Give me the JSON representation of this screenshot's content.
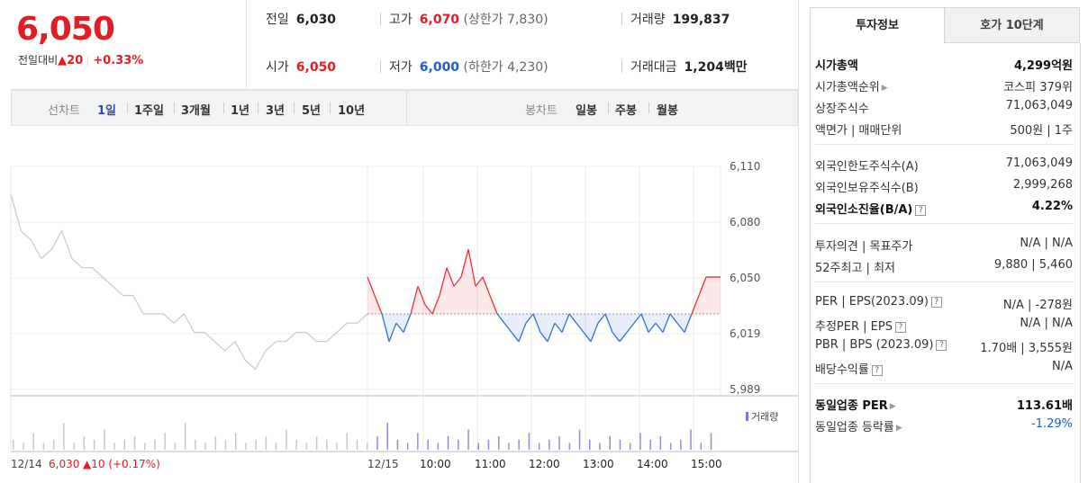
{
  "quote": {
    "price": "6,050",
    "change_label": "전일대비",
    "change_arrow": "▲",
    "change_amount": "20",
    "change_rate": "+0.33%",
    "prev_close_label": "전일",
    "prev_close": "6,030",
    "open_label": "시가",
    "open": "6,050",
    "high_label": "고가",
    "high": "6,070",
    "upper_limit": "(상한가 7,830)",
    "low_label": "저가",
    "low": "6,000",
    "lower_limit": "(하한가 4,230)",
    "volume_label": "거래량",
    "volume": "199,837",
    "amount_label": "거래대금",
    "amount": "1,204",
    "amount_unit": "백만"
  },
  "toolbar": {
    "line_label": "선차트",
    "periods": [
      "1일",
      "1주일",
      "3개월",
      "1년",
      "3년",
      "5년",
      "10년"
    ],
    "selected_period": "1일",
    "candle_label": "봉차트",
    "candles": [
      "일봉",
      "주봉",
      "월봉"
    ]
  },
  "chart_data": {
    "type": "line",
    "y_ticks": [
      "6,110",
      "6,080",
      "6,050",
      "6,019",
      "5,989"
    ],
    "ylim": [
      5989,
      6110
    ],
    "base_price": 6030,
    "x_ticks": [
      "12/15",
      "10:00",
      "11:00",
      "12:00",
      "13:00",
      "14:00",
      "15:00"
    ],
    "prev_day_label": "12/14",
    "prev_day_price": "6,030",
    "prev_day_change": "▲10 (+0.17%)",
    "volume_legend": "거래량",
    "prev_day_series": {
      "name": "12/14",
      "values": [
        6095,
        6075,
        6070,
        6060,
        6065,
        6075,
        6060,
        6055,
        6055,
        6050,
        6045,
        6040,
        6040,
        6030,
        6030,
        6030,
        6025,
        6030,
        6020,
        6020,
        6015,
        6010,
        6015,
        6005,
        6000,
        6010,
        6015,
        6015,
        6020,
        6020,
        6015,
        6015,
        6020,
        6025,
        6025,
        6030
      ]
    },
    "today_series": {
      "name": "12/15",
      "values": [
        6050,
        6040,
        6030,
        6015,
        6025,
        6020,
        6030,
        6045,
        6035,
        6030,
        6040,
        6055,
        6045,
        6050,
        6065,
        6045,
        6050,
        6040,
        6030,
        6025,
        6020,
        6015,
        6025,
        6030,
        6020,
        6015,
        6025,
        6020,
        6030,
        6025,
        6020,
        6015,
        6025,
        6030,
        6020,
        6015,
        6020,
        6025,
        6030,
        6020,
        6025,
        6020,
        6030,
        6025,
        6020,
        6030,
        6040,
        6050,
        6050,
        6050
      ]
    },
    "volume_values": [
      3,
      2,
      5,
      2,
      3,
      8,
      2,
      4,
      3,
      6,
      2,
      3,
      4,
      2,
      3,
      5,
      2,
      8,
      3,
      2,
      4,
      3,
      5,
      2,
      3,
      4,
      2,
      6,
      3,
      2,
      4,
      3,
      2,
      5,
      3,
      2,
      4,
      8,
      3,
      2,
      5,
      3,
      2,
      4,
      3,
      6,
      2,
      3,
      4,
      2,
      3,
      5,
      2,
      3,
      4,
      2,
      6,
      3,
      2,
      4,
      3,
      2,
      5,
      3,
      4,
      2,
      3,
      6,
      2,
      5
    ]
  },
  "panel": {
    "tab_invest": "투자정보",
    "tab_orderbook": "호가 10단계",
    "rows1": [
      {
        "k": "시가총액",
        "v": "4,299억원",
        "bold": true
      },
      {
        "k": "시가총액순위",
        "v": "코스피 379위",
        "arrow": true
      },
      {
        "k": "상장주식수",
        "v": "71,063,049"
      },
      {
        "k": "액면가 | 매매단위",
        "v": "500원 | 1주"
      }
    ],
    "rows2": [
      {
        "k": "외국인한도주식수(A)",
        "v": "71,063,049"
      },
      {
        "k": "외국인보유주식수(B)",
        "v": "2,999,268"
      },
      {
        "k": "외국인소진율(B/A)",
        "v": "4.22%",
        "bold": true,
        "q": true
      }
    ],
    "rows3": [
      {
        "k": "투자의견 | 목표주가",
        "v": "N/A | N/A"
      },
      {
        "k": "52주최고 | 최저",
        "v": "9,880 | 5,460"
      }
    ],
    "rows4": [
      {
        "k": "PER | EPS(2023.09)",
        "v": "N/A | -278원",
        "q": true
      },
      {
        "k": "추정PER | EPS",
        "v": "N/A | N/A",
        "q": true
      },
      {
        "k": "PBR | BPS (2023.09)",
        "v": "1.70배 | 3,555원",
        "q": true
      },
      {
        "k": "배당수익률",
        "v": "N/A",
        "q": true
      }
    ],
    "rows5": [
      {
        "k": "동일업종 PER",
        "v": "113.61배",
        "bold": true,
        "arrow": true
      },
      {
        "k": "동일업종 등락률",
        "v": "-1.29%",
        "arrow": true,
        "vcolor": "#1f5bd3"
      }
    ]
  }
}
